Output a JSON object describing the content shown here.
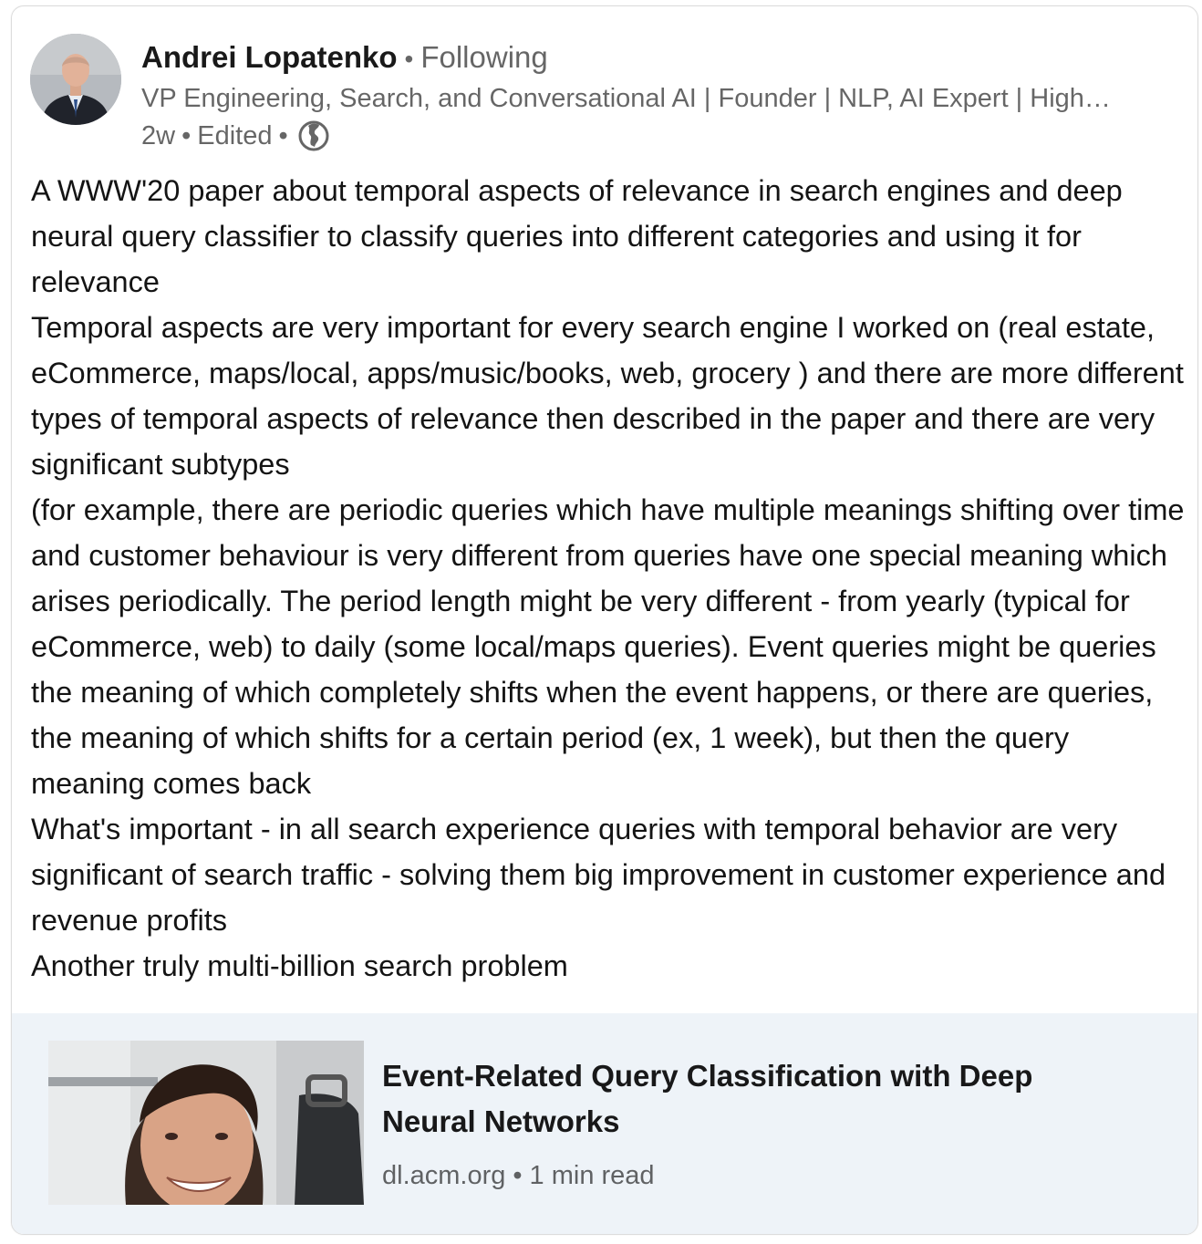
{
  "post": {
    "author": {
      "name": "Andrei Lopatenko",
      "separator": "•",
      "follow_status": "Following",
      "headline": "VP Engineering, Search, and Conversational AI | Founder | NLP, AI Expert | High…",
      "age": "2w",
      "dot": "•",
      "edited": "Edited",
      "visibility_icon": "globe-icon"
    },
    "body": [
      "A WWW'20 paper about temporal aspects of relevance in search engines and deep neural query classifier to classify queries into different categories and using it for relevance",
      "Temporal aspects are very important for every search engine I worked on (real estate, eCommerce, maps/local, apps/music/books, web, grocery ) and there are more different types of temporal aspects of relevance then described in the paper and there are very significant subtypes",
      "(for example, there are periodic queries which have multiple meanings shifting over time and customer behaviour is very different from queries have one special meaning which arises periodically. The period length might be very different - from yearly (typical for eCommerce, web) to daily (some local/maps queries). Event queries might be queries the meaning of which completely shifts when the event happens, or there are queries, the meaning of which shifts for a certain period (ex, 1 week), but then the query meaning comes back",
      "What's important - in all search experience queries with temporal behavior are very significant of search traffic - solving them big improvement in customer experience and revenue profits",
      "Another truly multi-billion search problem"
    ],
    "link_preview": {
      "title": "Event-Related Query Classification with Deep Neural Networks",
      "domain": "dl.acm.org",
      "dot": "•",
      "read_time": "1 min read"
    }
  },
  "colors": {
    "preview_background": "#eef3f8",
    "secondary_text": "#666666"
  }
}
